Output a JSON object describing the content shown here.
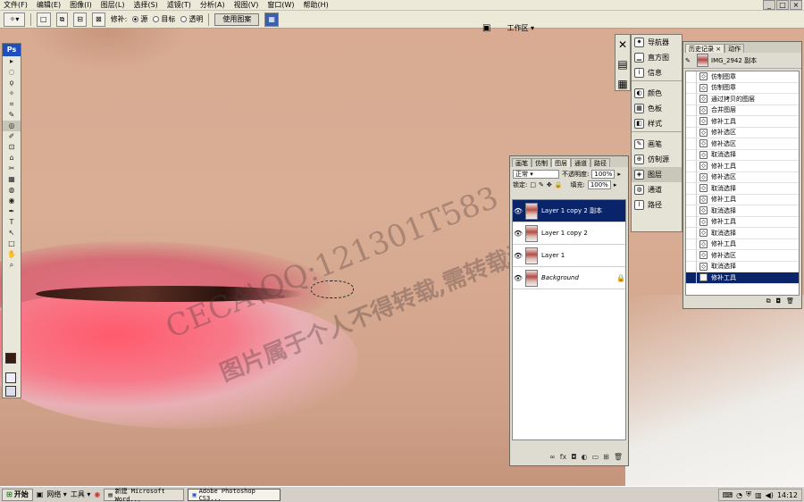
{
  "menubar": {
    "items": [
      "文件(F)",
      "编辑(E)",
      "图像(I)",
      "图层(L)",
      "选择(S)",
      "滤镜(T)",
      "分析(A)",
      "视图(V)",
      "窗口(W)",
      "帮助(H)"
    ],
    "window_controls": [
      "_",
      "□",
      "×"
    ]
  },
  "options": {
    "patch_label": "修补:",
    "source_label": "源",
    "dest_label": "目标",
    "transparent_label": "透明",
    "use_pattern_label": "使用图案",
    "workspace_label": "工作区 ▾"
  },
  "canvas": {
    "watermark_line1": "CECA\\QQ:121301T583",
    "watermark_line2": "图片属于个人不得转载,需转载请联系我"
  },
  "tools": {
    "logo": "Ps",
    "icons": [
      "▸",
      "◌",
      "ϙ",
      "✧",
      "⌗",
      "✎",
      "◎",
      "✐",
      "⊡",
      "⌂",
      "✂",
      "▦",
      "◍",
      "◉",
      "✒",
      "T",
      "↖",
      "□",
      "✋",
      "⌕"
    ]
  },
  "dock": {
    "navigator": "导航器",
    "histogram": "直方图",
    "info": "信息",
    "color": "颜色",
    "swatches": "色板",
    "styles": "样式",
    "brushes": "画笔",
    "clone_source": "仿制源",
    "layers": "图层",
    "channels": "通道",
    "paths": "路径"
  },
  "layers_panel": {
    "tabs": [
      "画笔",
      "仿制",
      "图层",
      "通道",
      "路径"
    ],
    "blend_mode": "正常",
    "opacity_label": "不透明度:",
    "opacity_value": "100%",
    "lock_label": "锁定:",
    "fill_label": "填充:",
    "fill_value": "100%",
    "layers": [
      {
        "name": "Layer 1 copy 2 副本",
        "selected": true
      },
      {
        "name": "Layer 1 copy 2",
        "selected": false
      },
      {
        "name": "Layer 1",
        "selected": false
      },
      {
        "name": "Background",
        "selected": false
      }
    ],
    "bottom_icons": [
      "∞",
      "fx",
      "◘",
      "◐",
      "▭",
      "⊞",
      "🗑"
    ]
  },
  "history_panel": {
    "tabs": [
      "历史记录 ×",
      "动作"
    ],
    "snapshot": "IMG_2942 副本",
    "items": [
      "仿制图章",
      "仿制图章",
      "通过拷贝的图层",
      "合并图层",
      "修补工具",
      "修补选区",
      "修补选区",
      "取消选择",
      "修补工具",
      "修补选区",
      "取消选择",
      "修补工具",
      "取消选择",
      "修补工具",
      "取消选择",
      "修补工具",
      "修补选区",
      "取消选择",
      "修补工具"
    ],
    "selected_index": 18
  },
  "taskbar": {
    "start": "开始",
    "network": "网络 ▾",
    "tools": "工具 ▾",
    "task_word": "新建 Microsoft Word...",
    "task_ps": "Adobe Photoshop CS3...",
    "clock": "14:12"
  }
}
